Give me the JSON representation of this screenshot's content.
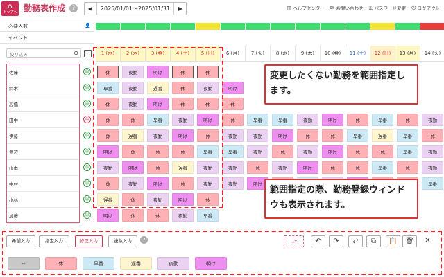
{
  "header": {
    "home_icon": "home-icon",
    "home_label": "トップへ",
    "title": "勤務表作成",
    "help": "?",
    "prev": "◀",
    "next": "▶",
    "range": "2025/01/01～2025/01/31",
    "links": [
      {
        "icon": "book-icon",
        "glyph": "▥",
        "label": "ヘルプセンター"
      },
      {
        "icon": "mail-icon",
        "glyph": "✉",
        "label": "お問い合わせ"
      },
      {
        "icon": "key-icon",
        "glyph": "⚿",
        "label": "パスワード変更"
      },
      {
        "icon": "logout-icon",
        "glyph": "⏻",
        "label": "ログアウト"
      }
    ]
  },
  "left": {
    "required_label": "必要人数",
    "event_label": "イベント",
    "filter_placeholder": "絞り込み",
    "zoom_glyph": "⊕"
  },
  "colors": {
    "holiday": "#ffb1b5",
    "early": "#cde9f6",
    "late": "#fff6cf",
    "night": "#ebd2f2",
    "dawn": "#ef8ff0",
    "none": "#c8c8c8",
    "accent": "#c8375a",
    "dash": "#e0272f"
  },
  "dates": [
    "1 (水)",
    "2 (木)",
    "3 (金)",
    "4 (土)",
    "5 (日)",
    "6 (月)",
    "7 (火)",
    "8 (水)",
    "9 (木)",
    "10 (金)",
    "11 (土)",
    "12 (日)",
    "13 (月)",
    "14 (火)"
  ],
  "need_status": [
    "green",
    "green",
    "green",
    "green",
    "yellow",
    "green",
    "green",
    "green",
    "green",
    "green",
    "green",
    "yellow",
    "green",
    "red"
  ],
  "staff": [
    {
      "name": "佐藤",
      "mood": "ok",
      "shifts": [
        "休",
        "夜勤",
        "明け",
        "休",
        "休",
        "",
        "",
        "",
        "",
        "",
        "",
        "",
        "",
        ""
      ]
    },
    {
      "name": "鈴木",
      "mood": "ok",
      "shifts": [
        "早番",
        "夜勤",
        "遅番",
        "休",
        "夜勤",
        "明け",
        "",
        "",
        "",
        "",
        "",
        "",
        "",
        ""
      ]
    },
    {
      "name": "高橋",
      "mood": "ok",
      "shifts": [
        "休",
        "夜勤",
        "明け",
        "休",
        "休",
        "休",
        "",
        "",
        "",
        "",
        "",
        "",
        "",
        ""
      ]
    },
    {
      "name": "田中",
      "mood": "ng",
      "shifts": [
        "休",
        "休",
        "早番",
        "夜勤",
        "明け",
        "休",
        "早番",
        "早番",
        "夜勤",
        "明け",
        "休",
        "早番",
        "休",
        "夜勤"
      ]
    },
    {
      "name": "伊藤",
      "mood": "ok",
      "shifts": [
        "休",
        "遅番",
        "夜勤",
        "明け",
        "休",
        "夜勤",
        "夜勤",
        "明け",
        "休",
        "休",
        "早番",
        "遅番",
        "早番",
        "休"
      ]
    },
    {
      "name": "渡辺",
      "mood": "ok",
      "shifts": [
        "明け",
        "休",
        "休",
        "休",
        "早番",
        "早番",
        "夜勤",
        "休",
        "夜勤",
        "明け",
        "休",
        "休",
        "早番",
        "夜勤"
      ]
    },
    {
      "name": "山本",
      "mood": "ok",
      "shifts": [
        "夜勤",
        "明け",
        "休",
        "遅番",
        "夜勤",
        "夜勤",
        "休",
        "夜勤",
        "明け",
        "休",
        "休",
        "早番",
        "休",
        "夜勤"
      ]
    },
    {
      "name": "中村",
      "mood": "ok",
      "shifts": [
        "休",
        "夜勤",
        "明け",
        "休",
        "夜勤",
        "夜勤",
        "明け",
        "休",
        "早番",
        "夜勤",
        "明け",
        "休",
        "休",
        "早番"
      ]
    },
    {
      "name": "小林",
      "mood": "ok",
      "shifts": [
        "遅番",
        "休",
        "夜勤",
        "明け",
        "休",
        "",
        "",
        "",
        "",
        "",
        "",
        "",
        "",
        ""
      ]
    },
    {
      "name": "加藤",
      "mood": "ok",
      "shifts": [
        "明け",
        "休",
        "休",
        "夜勤",
        "早番",
        "",
        "",
        "",
        "",
        "",
        "",
        "",
        "",
        ""
      ]
    }
  ],
  "callouts": {
    "c1": "変更したくない勤務を範囲指定します。",
    "c2": "範囲指定の際、勤務登録ウィンドウも表示されます。"
  },
  "toolbar": {
    "buttons": [
      "希望入力",
      "指定入力",
      "修正入力",
      "複数入力"
    ],
    "help": "?",
    "icons": [
      {
        "name": "range-select-icon",
        "glyph": "⬚▾"
      },
      {
        "name": "undo-icon",
        "glyph": "↶"
      },
      {
        "name": "redo-icon",
        "glyph": "↷"
      },
      {
        "name": "swap-icon",
        "glyph": "⇄"
      },
      {
        "name": "copy-icon",
        "glyph": "⧉"
      },
      {
        "name": "paste-icon",
        "glyph": "📋"
      },
      {
        "name": "trash-icon",
        "glyph": "🗑"
      },
      {
        "name": "close-icon",
        "glyph": "✕"
      }
    ]
  },
  "palette": [
    "--",
    "休",
    "早番",
    "遅番",
    "夜勤",
    "明け"
  ]
}
